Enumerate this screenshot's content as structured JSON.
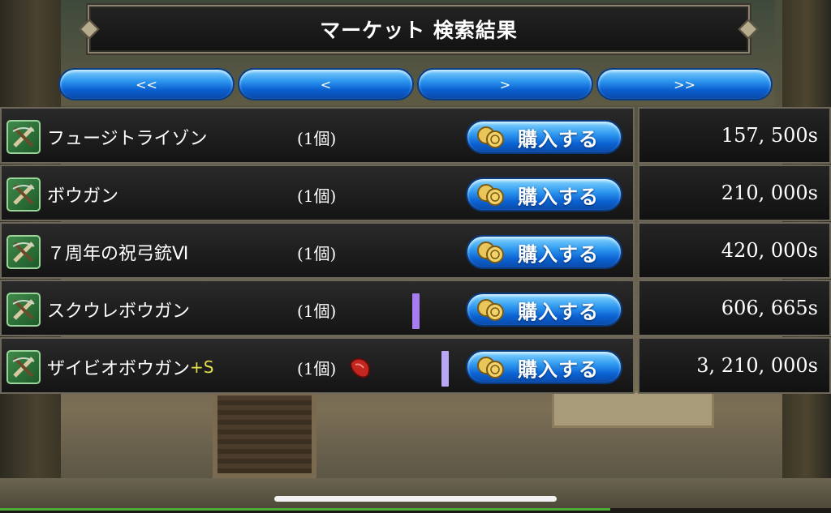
{
  "title": "マーケット 検索結果",
  "pagination": {
    "first": "<<",
    "prev": "<",
    "next": ">",
    "last": ">>"
  },
  "buy_label": "購入する",
  "items": [
    {
      "name": "フュージトライゾン",
      "suffix": "",
      "qty": "(1個)",
      "price": "157, 500s",
      "gem": false,
      "marker": ""
    },
    {
      "name": "ボウガン",
      "suffix": "",
      "qty": "(1個)",
      "price": "210, 000s",
      "gem": false,
      "marker": ""
    },
    {
      "name": "７周年の祝弓銃Ⅵ",
      "suffix": "",
      "qty": "(1個)",
      "price": "420, 000s",
      "gem": false,
      "marker": ""
    },
    {
      "name": "スクウレボウガン",
      "suffix": "",
      "qty": "(1個)",
      "price": "606, 665s",
      "gem": false,
      "marker": "#a77cf0"
    },
    {
      "name": "ザイビオボウガン",
      "suffix": "+S",
      "qty": "(1個)",
      "price": "3, 210, 000s",
      "gem": true,
      "marker": "#b8a6f2"
    }
  ],
  "icons": {
    "item": "crossbow-icon",
    "buy": "coin-icon",
    "gem": "red-gem-icon"
  },
  "colors": {
    "button_blue": "#2b94ee",
    "plus_text": "#e6e04a",
    "icon_green": "#3f8a4b"
  }
}
